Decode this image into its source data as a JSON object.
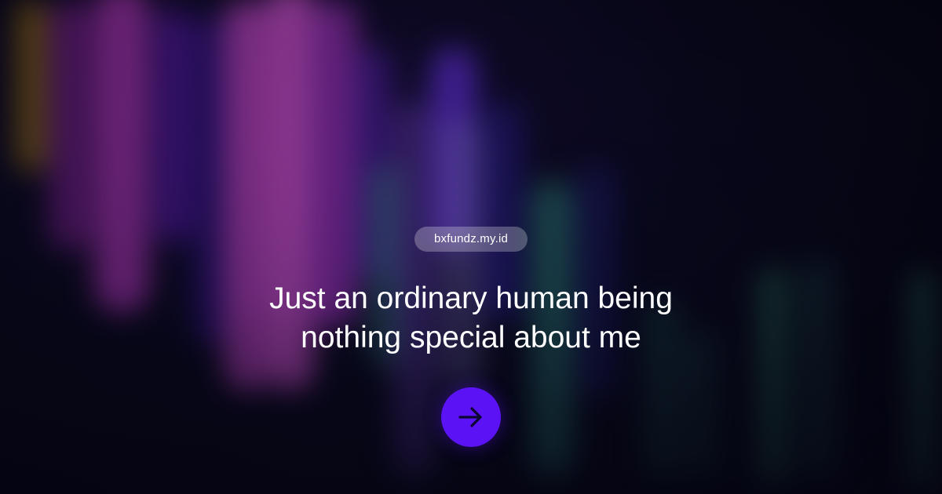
{
  "site": {
    "domain": "bxfundz.my.id"
  },
  "hero": {
    "line1": "Just an ordinary human being",
    "line2": "nothing special about me"
  },
  "cta": {
    "icon": "arrow-right-icon",
    "color": "#5b12f5"
  },
  "background": {
    "base_color": "#07071a",
    "accent_colors": [
      "#d24be0",
      "#7a2ff0",
      "#5a2de8",
      "#3fae9a",
      "#c9a02a"
    ]
  }
}
